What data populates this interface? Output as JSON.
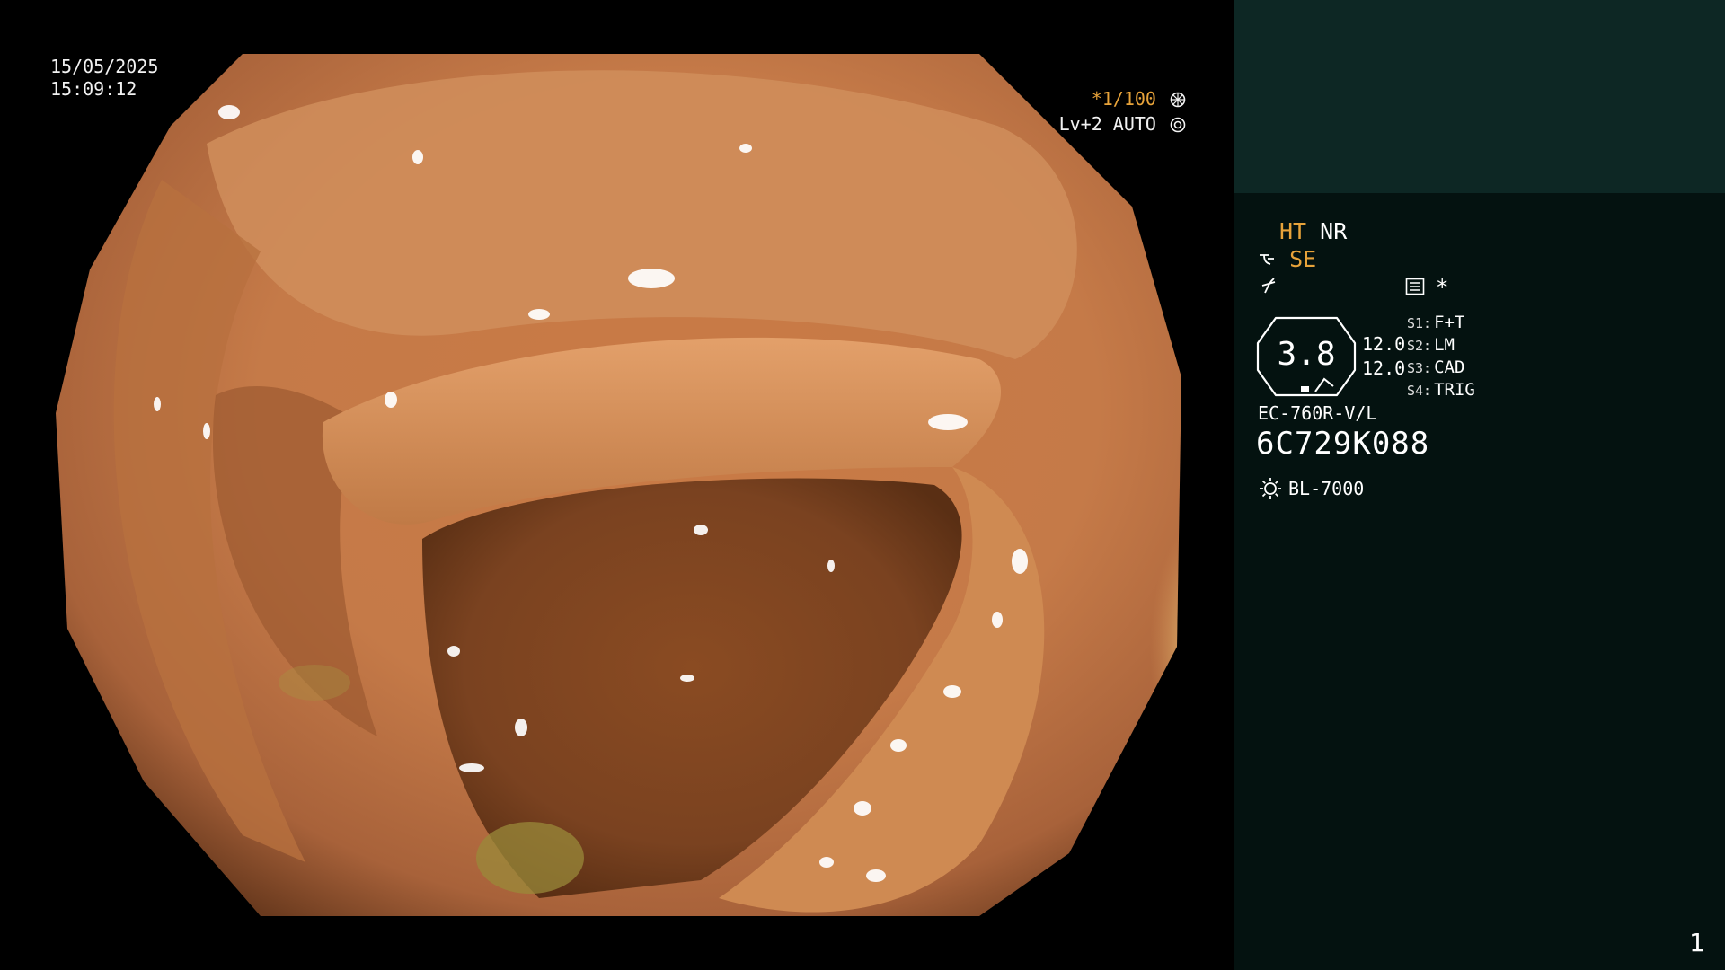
{
  "overlay": {
    "date": "15/05/2025",
    "time": "15:09:12",
    "shutter": "*1/100",
    "level": "Lv+2 AUTO"
  },
  "panel": {
    "mode_ht": "HT",
    "mode_nr": "NR",
    "mode_se": "SE",
    "asterisk": "*",
    "zoom": "3.8",
    "values": [
      "12.0",
      "12.0"
    ],
    "switches": [
      {
        "key": "S1:",
        "value": "F+T"
      },
      {
        "key": "S2:",
        "value": "LM"
      },
      {
        "key": "S3:",
        "value": "CAD"
      },
      {
        "key": "S4:",
        "value": "TRIG"
      }
    ],
    "scope_model": "EC-760R-V/L",
    "scope_serial": "6C729K088",
    "light_source": "BL-7000",
    "frame_number": "1"
  },
  "colors": {
    "panel_top": "#0d2724",
    "panel_main": "#041210",
    "accent": "#e8a33a"
  }
}
